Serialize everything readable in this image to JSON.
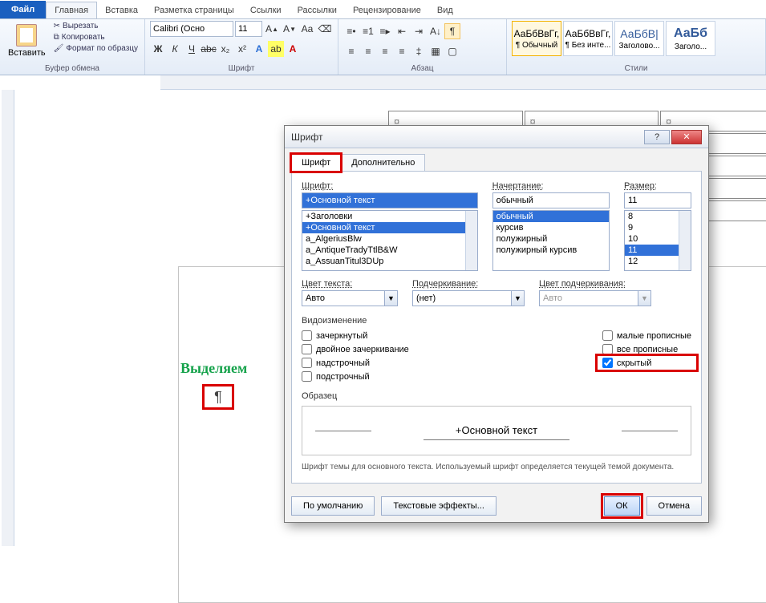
{
  "tabs": {
    "file": "Файл",
    "items": [
      "Главная",
      "Вставка",
      "Разметка страницы",
      "Ссылки",
      "Рассылки",
      "Рецензирование",
      "Вид"
    ],
    "active": 0
  },
  "ribbon": {
    "clipboard": {
      "label": "Буфер обмена",
      "paste": "Вставить",
      "cut": "Вырезать",
      "copy": "Копировать",
      "format": "Формат по образцу"
    },
    "font": {
      "label": "Шрифт",
      "name": "Calibri (Осно",
      "size": "11"
    },
    "paragraph": {
      "label": "Абзац"
    },
    "styles": {
      "label": "Стили",
      "items": [
        {
          "sample": "АаБбВвГг,",
          "name": "¶ Обычный"
        },
        {
          "sample": "АаБбВвГг,",
          "name": "¶ Без инте..."
        },
        {
          "sample": "АаБбВ|",
          "name": "Заголово..."
        },
        {
          "sample": "АаБб",
          "name": "Заголо..."
        }
      ]
    }
  },
  "note": "Выделяем",
  "pilcrow": "¶",
  "tablecell": "¤",
  "dialog": {
    "title": "Шрифт",
    "tabs": [
      "Шрифт",
      "Дополнительно"
    ],
    "labels": {
      "font": "Шрифт:",
      "style": "Начертание:",
      "size": "Размер:",
      "color": "Цвет текста:",
      "underline": "Подчеркивание:",
      "ucolor": "Цвет подчеркивания:",
      "effects": "Видоизменение",
      "sample": "Образец"
    },
    "font_value": "+Основной текст",
    "font_list": [
      "+Заголовки",
      "+Основной текст",
      "a_AlgeriusBlw",
      "a_AntiqueTradyTtlB&W",
      "a_AssuanTitul3DUp"
    ],
    "style_value": "обычный",
    "style_list": [
      "обычный",
      "курсив",
      "полужирный",
      "полужирный курсив"
    ],
    "size_value": "11",
    "size_list": [
      "8",
      "9",
      "10",
      "11",
      "12"
    ],
    "color_value": "Авто",
    "underline_value": "(нет)",
    "ucolor_value": "Авто",
    "effects_left": [
      "зачеркнутый",
      "двойное зачеркивание",
      "надстрочный",
      "подстрочный"
    ],
    "effects_right": [
      "малые прописные",
      "все прописные",
      "скрытый"
    ],
    "sample_text": "+Основной текст",
    "sample_desc": "Шрифт темы для основного текста. Используемый шрифт определяется текущей темой документа.",
    "buttons": {
      "default": "По умолчанию",
      "texteff": "Текстовые эффекты...",
      "ok": "ОК",
      "cancel": "Отмена"
    }
  }
}
